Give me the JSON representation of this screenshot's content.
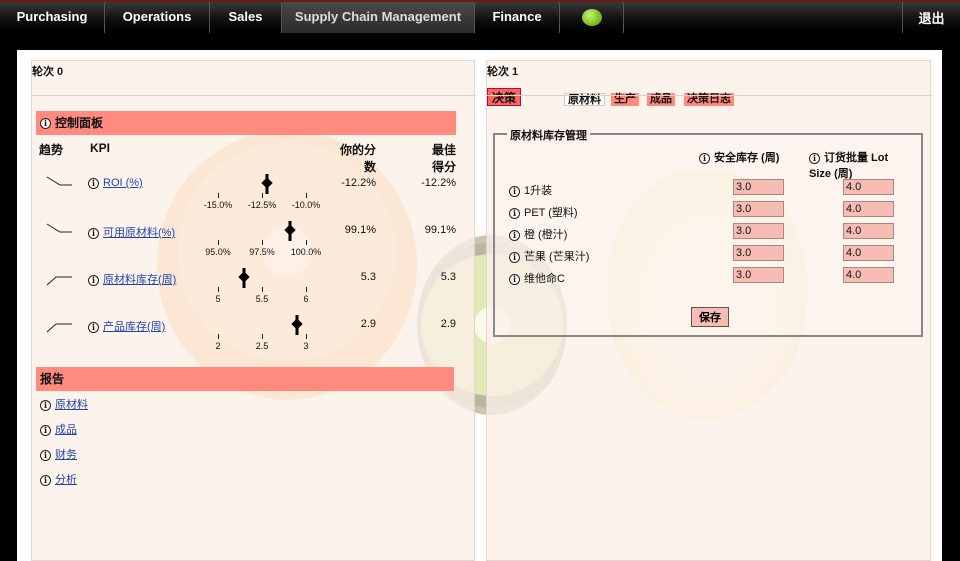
{
  "nav": {
    "items": [
      "Purchasing",
      "Operations",
      "Sales",
      "Supply Chain Management",
      "Finance"
    ],
    "active": "Supply Chain Management",
    "logout": "退出"
  },
  "left": {
    "round_label": "轮次 0",
    "dashboard_title": "控制面板",
    "col_trend": "趋势",
    "col_kpi": "KPI",
    "col_your_score": "你的分\n数",
    "col_your_score_l1": "你的分",
    "col_your_score_l2": "数",
    "col_best_l1": "最佳",
    "col_best_l2": "得分",
    "kpis": [
      {
        "name": "ROI (%)",
        "your": "-12.2%",
        "best": "-12.2%",
        "trend": "down",
        "ticks": [
          "-15.0%",
          "-12.5%",
          "-10.0%"
        ],
        "tick_values": [
          -15.0,
          -12.5,
          -10.0
        ],
        "marker_value": -12.2,
        "best_value": -12.2
      },
      {
        "name": "可用原材料(%)",
        "your": "99.1%",
        "best": "99.1%",
        "trend": "down",
        "ticks": [
          "95.0%",
          "97.5%",
          "100.0%"
        ],
        "tick_values": [
          95.0,
          97.5,
          100.0
        ],
        "marker_value": 99.1,
        "best_value": 99.1
      },
      {
        "name": "原材料库存(周)",
        "your": "5.3",
        "best": "5.3",
        "trend": "up",
        "ticks": [
          "5",
          "5.5",
          "6"
        ],
        "tick_values": [
          5,
          5.5,
          6
        ],
        "marker_value": 5.3,
        "best_value": 5.3
      },
      {
        "name": "产品库存(周)",
        "your": "2.9",
        "best": "2.9",
        "trend": "up",
        "ticks": [
          "2",
          "2.5",
          "3"
        ],
        "tick_values": [
          2,
          2.5,
          3
        ],
        "marker_value": 2.9,
        "best_value": 2.9
      }
    ],
    "report_title": "报告",
    "reports": [
      "原材料",
      "成品",
      "财务",
      "分析"
    ]
  },
  "right": {
    "round_label": "轮次 1",
    "decision_label": "决策",
    "tabs": [
      "原材料",
      "生产",
      "成品",
      "决策日志"
    ],
    "active_tab": "原材料",
    "section_title": "原材料库存管理",
    "col_safety": "安全库存 (周)",
    "col_lot_l1": "订货批量 Lot",
    "col_lot_l2": "Size (周)",
    "materials": [
      {
        "name": "1升装",
        "safety": "3.0",
        "lot": "4.0"
      },
      {
        "name": "PET (塑料)",
        "safety": "3.0",
        "lot": "4.0"
      },
      {
        "name": "橙 (橙汁)",
        "safety": "3.0",
        "lot": "4.0"
      },
      {
        "name": "芒果 (芒果汁)",
        "safety": "3.0",
        "lot": "4.0"
      },
      {
        "name": "维他命C",
        "safety": "3.0",
        "lot": "4.0"
      }
    ],
    "save_label": "保存"
  }
}
